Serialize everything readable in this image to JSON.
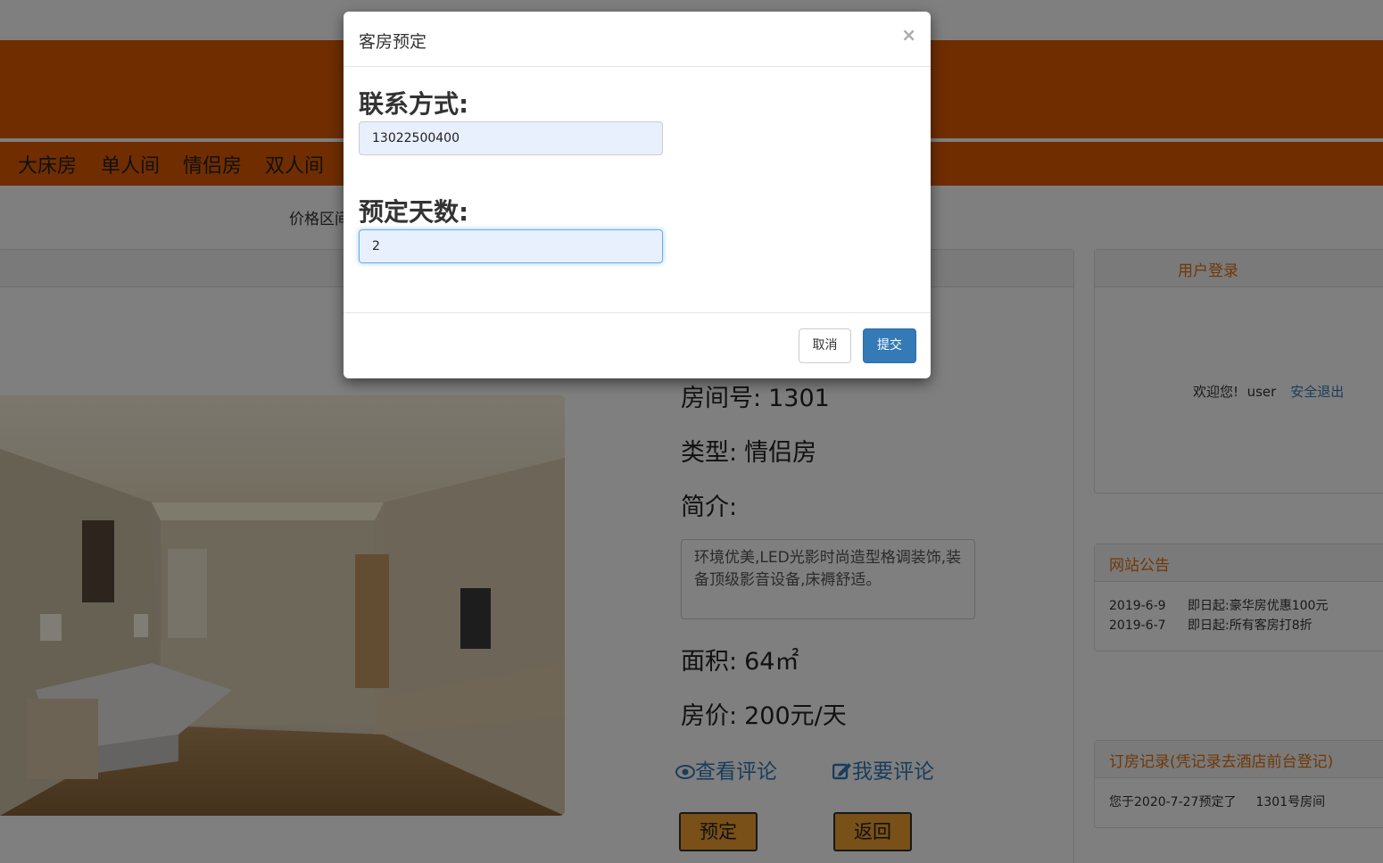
{
  "nav": {
    "items": [
      "大床房",
      "单人间",
      "情侣房",
      "双人间"
    ]
  },
  "filter": {
    "price_label": "价格区间"
  },
  "room": {
    "number_label": "房间号:",
    "number": "1301",
    "type_label": "类型:",
    "type": "情侣房",
    "intro_label": "简介:",
    "description": "环境优美,LED光影时尚造型格调装饰,装备顶级影音设备,床褥舒适。",
    "area_label": "面积:",
    "area": "64㎡",
    "price_label": "房价:",
    "price": "200元/天",
    "view_comments": "查看评论",
    "write_comment": "我要评论",
    "book_button": "预定",
    "back_button": "返回"
  },
  "sidebar": {
    "login_title": "用户登录",
    "welcome": "欢迎您!",
    "username": "user",
    "logout": "安全退出",
    "notice_title": "网站公告",
    "notices": [
      {
        "date": "2019-6-9",
        "text": "即日起:豪华房优惠100元"
      },
      {
        "date": "2019-6-7",
        "text": "即日起:所有客房打8折"
      }
    ],
    "record_title": "订房记录(凭记录去酒店前台登记)",
    "record_text": "您于2020-7-27预定了",
    "record_room": "1301号房间"
  },
  "modal": {
    "title": "客房预定",
    "close": "×",
    "contact_label": "联系方式:",
    "contact_value": "13022500400",
    "days_label": "预定天数:",
    "days_value": "2",
    "cancel": "取消",
    "submit": "提交"
  },
  "colors": {
    "header": "#e05a00",
    "primary": "#337ab7",
    "accent_orange": "#f0a030"
  }
}
